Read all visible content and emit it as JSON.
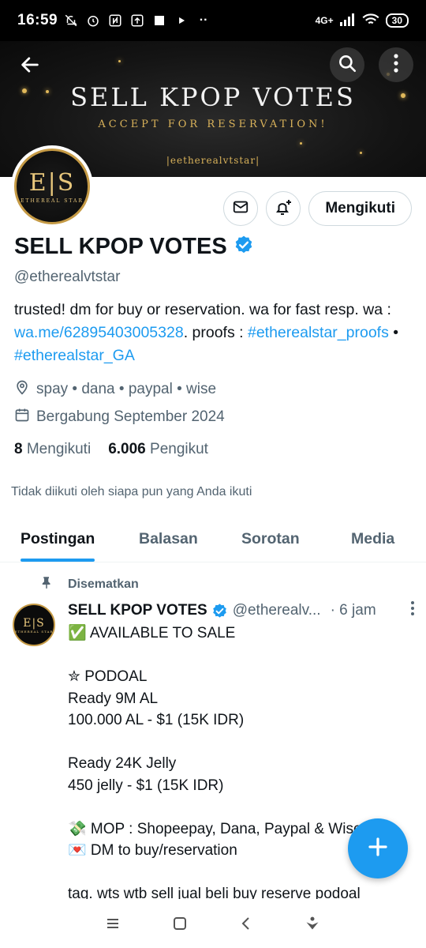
{
  "status_bar": {
    "time": "16:59",
    "network": "4G+",
    "battery": "30"
  },
  "banner": {
    "title": "SELL KPOP VOTES",
    "subtitle": "ACCEPT FOR RESERVATION!",
    "handle": "|eetherealvtstar|"
  },
  "avatar": {
    "monogram": "E|S",
    "caption": "ETHEREAL STAR"
  },
  "actions": {
    "follow_label": "Mengikuti"
  },
  "profile": {
    "name": "SELL KPOP VOTES",
    "handle": "@etherealvtstar",
    "bio_prefix": "trusted! dm for buy or reservation. wa for fast resp. wa : ",
    "bio_link": "wa.me/62895403005328",
    "bio_mid": ". proofs : ",
    "bio_tag1": "#etherealstar_proofs",
    "bio_sep": " • ",
    "bio_tag2": "#etherealstar_GA",
    "location": "spay • dana • paypal • wise",
    "joined": "Bergabung September 2024",
    "following_count": "8",
    "following_label": "Mengikuti",
    "followers_count": "6.006",
    "followers_label": "Pengikut",
    "not_followed": "Tidak diikuti oleh siapa pun yang Anda ikuti"
  },
  "tabs": [
    {
      "label": "Postingan",
      "active": true
    },
    {
      "label": "Balasan",
      "active": false
    },
    {
      "label": "Sorotan",
      "active": false
    },
    {
      "label": "Media",
      "active": false
    }
  ],
  "post": {
    "pinned_label": "Disematkan",
    "author": "SELL KPOP VOTES",
    "handle": "@etherealv...",
    "time": "· 6 jam",
    "body": "✅ AVAILABLE TO SALE\n\n✮ PODOAL\nReady 9M AL\n100.000 AL - $1 (15K IDR)\n\nReady 24K Jelly\n450 jelly - $1 (15K IDR)\n\n💸 MOP : Shopeepay, Dana, Paypal & Wise\n💌 DM to buy/reservation\n\ntag. wts wtb sell jual beli buy reserve podoal"
  },
  "colors": {
    "accent": "#1d9bf0",
    "text": "#0f1419",
    "muted": "#536471",
    "gold": "#d9b25a"
  }
}
